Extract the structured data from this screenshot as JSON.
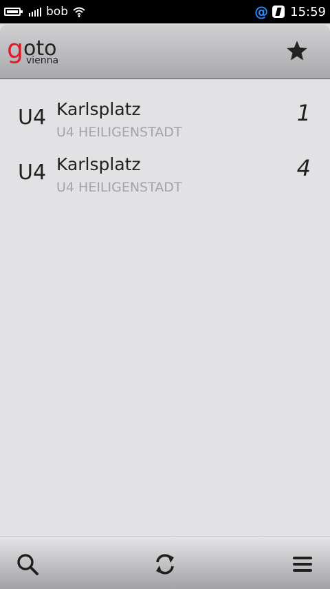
{
  "status_bar": {
    "carrier": "bob",
    "time": "15:59"
  },
  "header": {
    "logo_main_first": "g",
    "logo_main_rest": "oto",
    "logo_sub": "vienna"
  },
  "departures": [
    {
      "line": "U4",
      "station": "Karlsplatz",
      "direction": "U4 HEILIGENSTADT",
      "minutes": "1"
    },
    {
      "line": "U4",
      "station": "Karlsplatz",
      "direction": "U4 HEILIGENSTADT",
      "minutes": "4"
    }
  ],
  "icons": {
    "favorites": "star-icon",
    "search": "search-icon",
    "refresh": "refresh-icon",
    "menu": "menu-icon"
  },
  "colors": {
    "logo_accent": "#e01b2c",
    "status_accent": "#2e8bff"
  }
}
